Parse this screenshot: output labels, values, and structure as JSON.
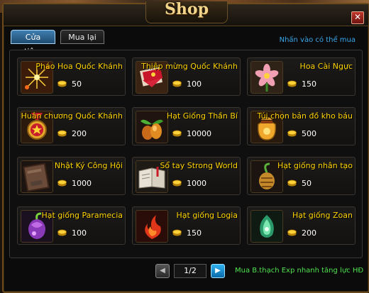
{
  "window": {
    "title": "Shop",
    "close_label": "✕"
  },
  "tabs": [
    {
      "label": "Cửa tiệm",
      "active": true
    },
    {
      "label": "Mua lại",
      "active": false
    }
  ],
  "hint": "Nhấn vào có thể mua",
  "items": [
    {
      "name": "Pháo Hoa Quốc Khánh",
      "price": "50",
      "icon": "firework-icon"
    },
    {
      "name": "Thiệp mừng Quốc Khánh",
      "price": "100",
      "icon": "greeting-card-icon"
    },
    {
      "name": "Hoa Cài Ngực",
      "price": "150",
      "icon": "corsage-flower-icon"
    },
    {
      "name": "Huân chương Quốc Khánh",
      "price": "200",
      "icon": "medal-icon"
    },
    {
      "name": "Hạt Giống Thần Bí",
      "price": "10000",
      "icon": "mystic-seed-icon"
    },
    {
      "name": "Túi chọn bản đồ kho báu",
      "price": "500",
      "icon": "treasure-bag-icon"
    },
    {
      "name": "Nhật Ký Công Hội",
      "price": "1000",
      "icon": "guild-diary-icon"
    },
    {
      "name": "Sổ tay Strong World",
      "price": "1000",
      "icon": "handbook-icon"
    },
    {
      "name": "Hạt giống nhân tạo",
      "price": "50",
      "icon": "artificial-seed-icon"
    },
    {
      "name": "Hạt giống Paramecia",
      "price": "100",
      "icon": "paramecia-seed-icon"
    },
    {
      "name": "Hạt giống Logia",
      "price": "150",
      "icon": "logia-seed-icon"
    },
    {
      "name": "Hạt giống Zoan",
      "price": "200",
      "icon": "zoan-seed-icon"
    }
  ],
  "pager": {
    "prev_label": "◀",
    "next_label": "▶",
    "page_text": "1/2"
  },
  "promo": "Mua B.thạch Exp nhanh tăng lực HĐ",
  "colors": {
    "item_name": "#ffd400",
    "hint": "#38a7ea",
    "promo": "#4fe24f",
    "tab_active": "#3f7fb0"
  }
}
